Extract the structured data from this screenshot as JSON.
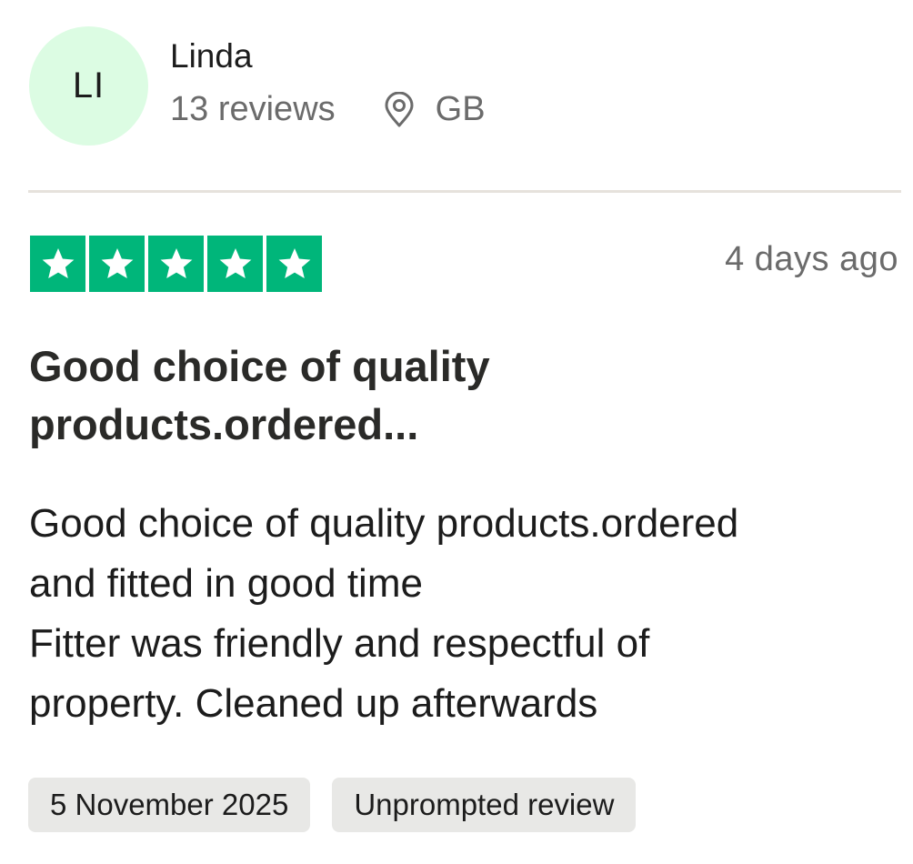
{
  "consumer": {
    "initials": "LI",
    "name": "Linda",
    "reviews_count": "13 reviews",
    "country": "GB",
    "avatar_color": "#dcfce3",
    "location_icon": "map-pin-icon"
  },
  "review": {
    "rating": 5,
    "star_color": "#00b67a",
    "date_relative": "4 days ago",
    "title_line1": "Good choice of quality",
    "title_line2": "products.ordered...",
    "body_lines": [
      "Good choice of quality products.ordered",
      "and fitted in good time",
      "Fitter was friendly and respectful of",
      "property. Cleaned up afterwards"
    ],
    "date_of_experience": "5 November 2025",
    "source_label": "Unprompted review"
  }
}
